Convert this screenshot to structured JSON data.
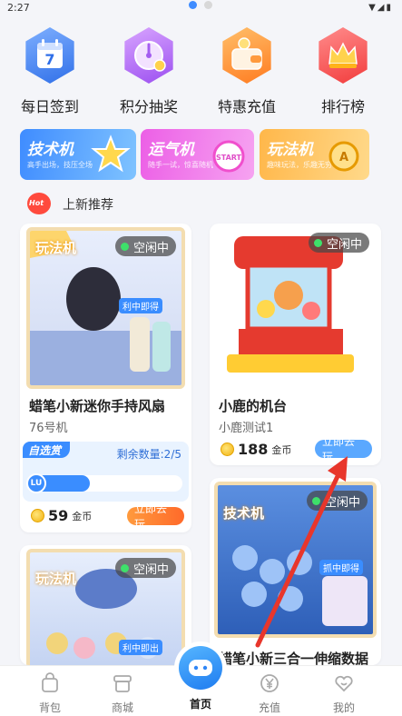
{
  "status_bar": {
    "time": "2:27"
  },
  "quick_actions": [
    {
      "label": "每日签到",
      "icon": "calendar-icon",
      "day": "7",
      "color": "#3f7df0"
    },
    {
      "label": "积分抽奖",
      "icon": "lottery-icon",
      "color": "#b36af2"
    },
    {
      "label": "特惠充值",
      "icon": "wallet-icon",
      "color": "#ff8a2a"
    },
    {
      "label": "排行榜",
      "icon": "crown-icon",
      "color": "#ff4d4d"
    }
  ],
  "banners": [
    {
      "title": "技术机",
      "subtitle": "高手出场，技压全场",
      "color": "#3f8cff"
    },
    {
      "title": "运气机",
      "subtitle": "随手一试，惊喜随机",
      "color": "#e65ae0"
    },
    {
      "title": "玩法机",
      "subtitle": "趣味玩法，乐趣无穷",
      "color": "#ffb347"
    }
  ],
  "section": {
    "badge": "Hot",
    "title": "上新推荐"
  },
  "products": [
    {
      "title": "蜡笔小新迷你手持风扇",
      "subtitle": "76号机",
      "status": "空闲中",
      "thumb_badge": "玩法机",
      "thumb_tag": "利中即得",
      "self_pick": {
        "tag": "自选赏",
        "remaining": "剩余数量:2/5",
        "progress": 0.4,
        "level": "LU"
      },
      "price": "59",
      "unit": "金币",
      "action": "立即去玩"
    },
    {
      "title": "小鹿的机台",
      "subtitle": "小鹿测试1",
      "status": "空闲中",
      "price": "188",
      "unit": "金币",
      "action": "立即去玩"
    },
    {
      "title": "蜡笔小新三合一伸缩数据",
      "status": "空闲中",
      "thumb_badge": "技术机",
      "thumb_tag": "抓中即得"
    },
    {
      "status": "空闲中",
      "thumb_badge": "玩法机",
      "thumb_tag": "利中即出"
    }
  ],
  "tabbar": [
    {
      "label": "背包",
      "icon": "bag-icon"
    },
    {
      "label": "商城",
      "icon": "store-icon"
    },
    {
      "label": "首页",
      "icon": "game-controller-icon",
      "active": true
    },
    {
      "label": "充值",
      "icon": "yen-icon"
    },
    {
      "label": "我的",
      "icon": "heart-profile-icon"
    }
  ]
}
